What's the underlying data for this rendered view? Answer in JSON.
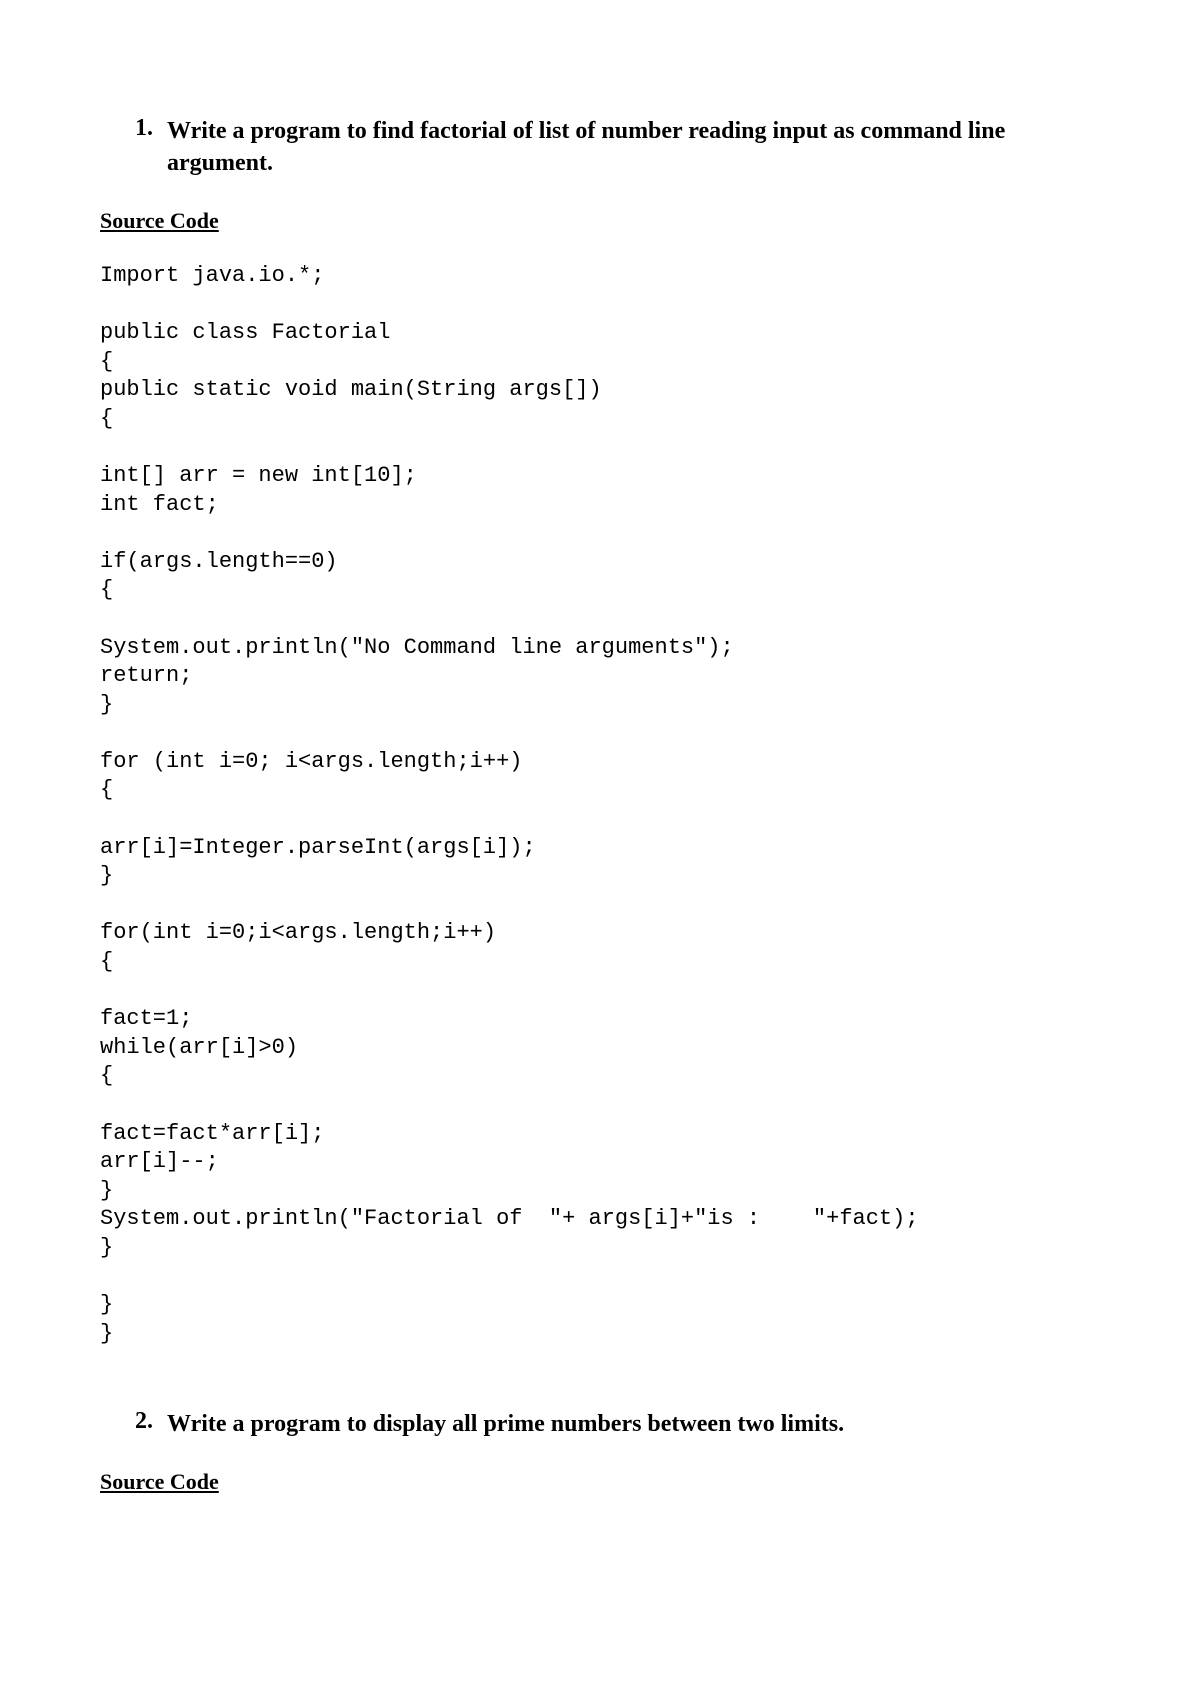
{
  "question1": {
    "number": "1.",
    "text": "Write a program to find factorial of list of number reading input as command line argument."
  },
  "section_label_1": "Source Code",
  "code1": "Import java.io.*;\n\npublic class Factorial\n{\npublic static void main(String args[])\n{\n\nint[] arr = new int[10];\nint fact;\n\nif(args.length==0)\n{\n\nSystem.out.println(\"No Command line arguments\");\nreturn;\n}\n\nfor (int i=0; i<args.length;i++)\n{\n\narr[i]=Integer.parseInt(args[i]);\n}\n\nfor(int i=0;i<args.length;i++)\n{\n\nfact=1;\nwhile(arr[i]>0)\n{\n\nfact=fact*arr[i];\narr[i]--;\n}\nSystem.out.println(\"Factorial of  \"+ args[i]+\"is :    \"+fact);\n}\n\n}\n}",
  "question2": {
    "number": "2.",
    "text": "Write a program to display all prime numbers between two limits."
  },
  "section_label_2": "Source Code"
}
